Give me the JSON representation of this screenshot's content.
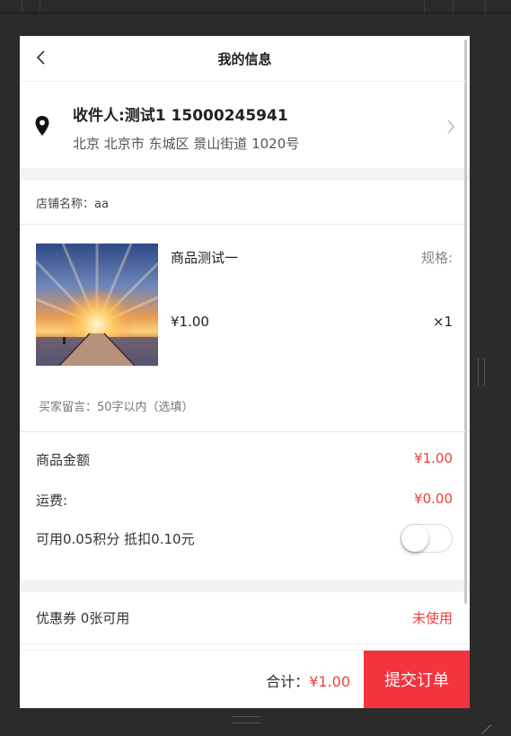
{
  "header": {
    "title": "我的信息"
  },
  "address": {
    "recipient": "收件人:测试1 15000245941",
    "detail": "北京 北京市 东城区 景山街道 1020号"
  },
  "shop": {
    "label": "店铺名称：aa"
  },
  "product": {
    "name": "商品测试一",
    "spec": "规格:",
    "price": "¥1.00",
    "quantity": "×1",
    "note_placeholder": "买家留言：50字以内（选填）"
  },
  "summary": {
    "goods_amount_label": "商品金额",
    "goods_amount_value": "¥1.00",
    "shipping_label": "运费:",
    "shipping_value": "¥0.00",
    "points_label": "可用0.05积分 抵扣0.10元",
    "points_enabled": false
  },
  "coupon": {
    "label": "优惠券 0张可用",
    "status": "未使用"
  },
  "footer": {
    "total_label": "合计：",
    "total_value": "¥1.00",
    "submit_label": "提交订单"
  },
  "colors": {
    "accent": "#f5333f",
    "price_red": "#f0413a"
  },
  "icons": [
    "back-icon",
    "location-pin-icon",
    "chevron-right-icon"
  ]
}
